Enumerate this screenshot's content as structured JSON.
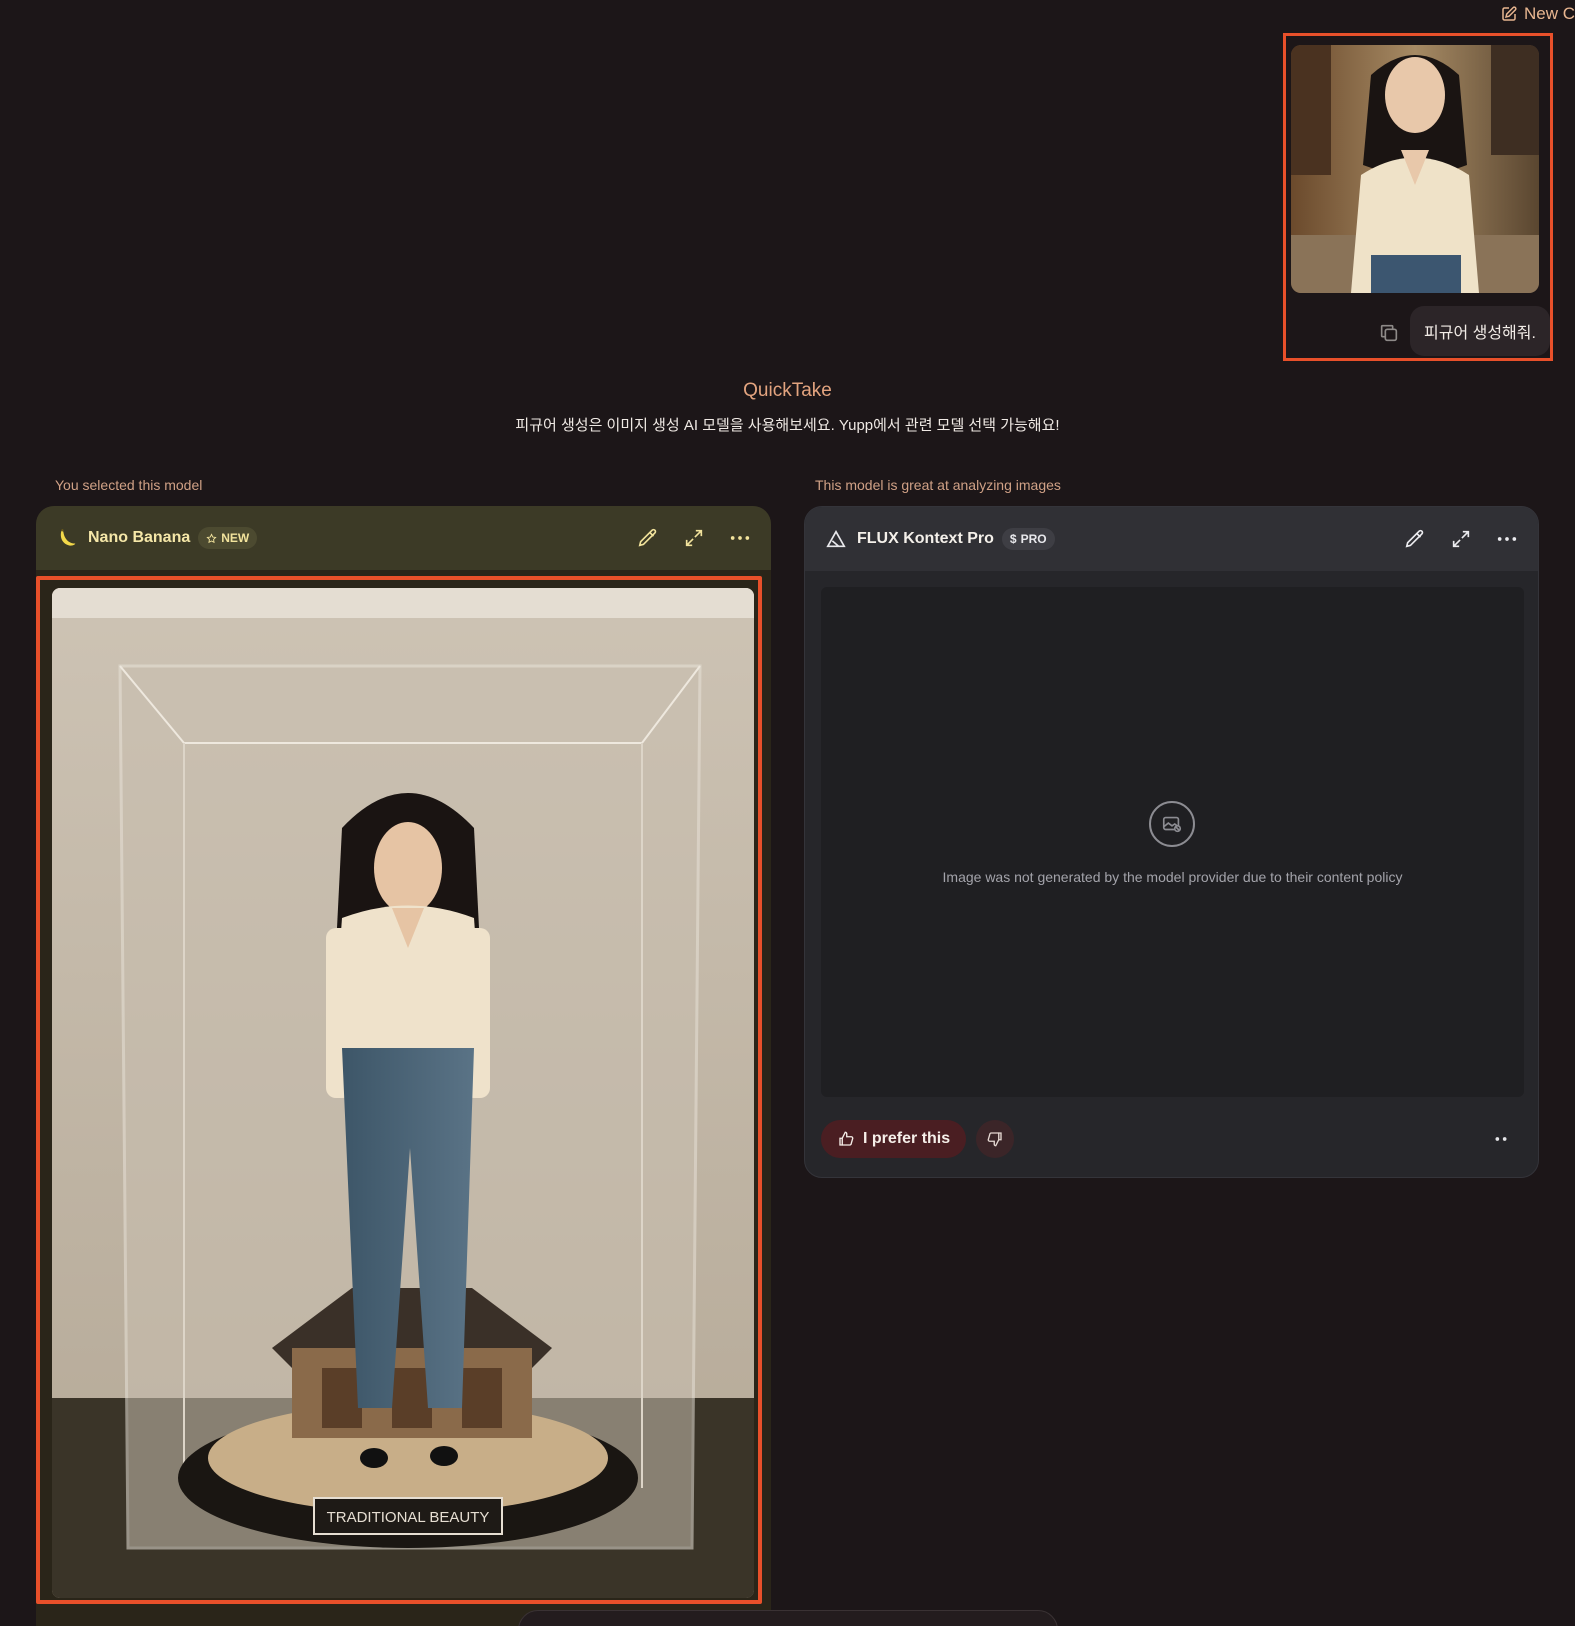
{
  "topbar": {
    "new_chat_label": "New C"
  },
  "user_message": {
    "prompt_text": "피규어 생성해줘.",
    "attachment_icon": "photo-thumbnail"
  },
  "quicktake": {
    "title": "QuickTake",
    "body": "피규어 생성은 이미지 생성 AI 모델을 사용해보세요. Yupp에서 관련 모델 선택 가능해요!"
  },
  "left_column": {
    "label": "You selected this model",
    "model_name": "Nano Banana",
    "badge": "NEW",
    "image_caption": "TRADITIONAL BEAUTY",
    "accent_color": "#f2e39c"
  },
  "right_column": {
    "label": "This model is great at analyzing images",
    "model_name": "FLUX Kontext Pro",
    "badge_symbol": "$",
    "badge": "PRO",
    "blocked_message": "Image was not generated by the model provider due to their content policy",
    "prefer_label": "I prefer this"
  },
  "colors": {
    "background": "#1c1618",
    "highlight_border": "#e8502a",
    "quicktake_title": "#e3a47f"
  }
}
